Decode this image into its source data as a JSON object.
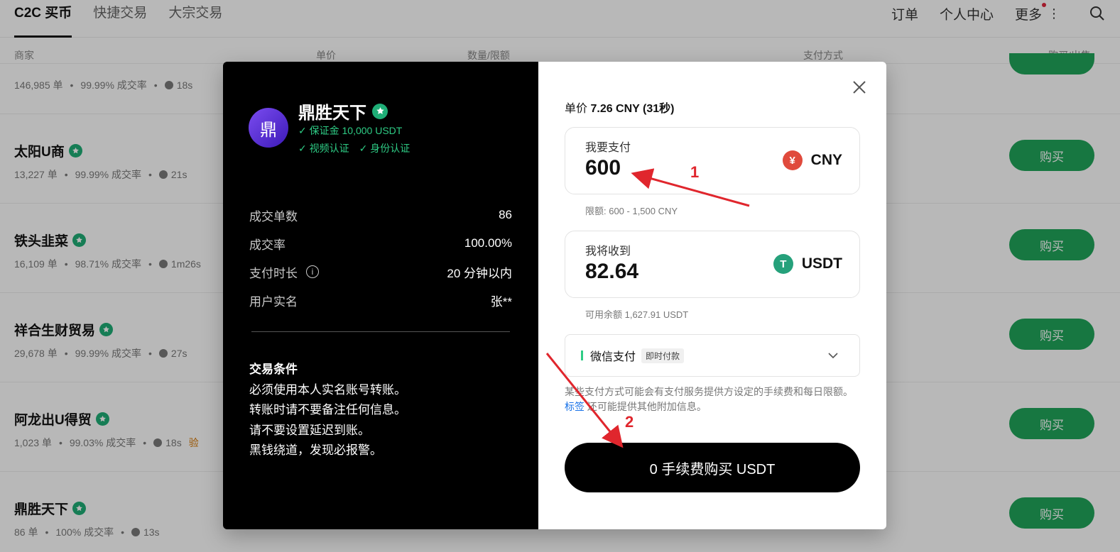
{
  "nav": {
    "tabs": [
      "C2C 买币",
      "快捷交易",
      "大宗交易"
    ],
    "right": [
      "订单",
      "个人中心",
      "更多"
    ]
  },
  "table_header": {
    "merchant": "商家",
    "price": "单价",
    "amount": "数量/限额",
    "payment": "支付方式",
    "action": "购买/出售"
  },
  "rows": [
    {
      "name": "",
      "orders": "146,985 单",
      "rate": "99.99% 成交率",
      "time": "18s",
      "buy": ""
    },
    {
      "name": "太阳U商",
      "orders": "13,227 单",
      "rate": "99.99% 成交率",
      "time": "21s",
      "buy": "购买"
    },
    {
      "name": "铁头韭菜",
      "orders": "16,109 单",
      "rate": "98.71% 成交率",
      "time": "1m26s",
      "buy": "购买"
    },
    {
      "name": "祥合生财贸易",
      "orders": "29,678 单",
      "rate": "99.99% 成交率",
      "time": "27s",
      "buy": "购买"
    },
    {
      "name": "阿龙出U得贸",
      "orders": "1,023 单",
      "rate": "99.03% 成交率",
      "time": "18s",
      "verify": "验",
      "buy": "购买"
    },
    {
      "name": "鼎胜天下",
      "orders": "86 单",
      "rate": "100% 成交率",
      "time": "13s",
      "buy": "购买"
    }
  ],
  "modal": {
    "merchant": {
      "avatar_char": "鼎",
      "name": "鼎胜天下",
      "deposit": "✓ 保证金 10,000 USDT",
      "video": "✓ 视频认证",
      "id": "✓ 身份认证"
    },
    "stats": [
      {
        "label": "成交单数",
        "value": "86"
      },
      {
        "label": "成交率",
        "value": "100.00%"
      },
      {
        "label": "支付时长",
        "value": "20 分钟以内"
      },
      {
        "label": "用户实名",
        "value": "张**"
      }
    ],
    "terms": {
      "title": "交易条件",
      "lines": [
        "必须使用本人实名账号转账。",
        "转账时请不要备注任何信息。",
        "请不要设置延迟到账。",
        "黑钱绕道，发现必报警。"
      ]
    },
    "price_label": "单价",
    "price_value": "7.26 CNY (31秒)",
    "pay": {
      "label": "我要支付",
      "value": "600",
      "currency": "CNY",
      "icon": "¥"
    },
    "pay_hint": "限额: 600 - 1,500 CNY",
    "receive": {
      "label": "我将收到",
      "value": "82.64",
      "currency": "USDT",
      "icon": "T"
    },
    "receive_hint": "可用余额 1,627.91 USDT",
    "payment_method": {
      "name": "微信支付",
      "tag": "即时付款"
    },
    "note_pre": "某些支付方式可能会有支付服务提供方设定的手续费和每日限额。",
    "note_link": "标签",
    "note_post": " 还可能提供其他附加信息。",
    "buy_label": "0 手续费购买 USDT"
  },
  "annotations": {
    "arrow1": "1",
    "arrow2": "2",
    "color": "#e0262d"
  },
  "colors": {
    "buy_green": "#21a55a",
    "verified": "#1fae77",
    "accent_green": "#2ecc85"
  }
}
